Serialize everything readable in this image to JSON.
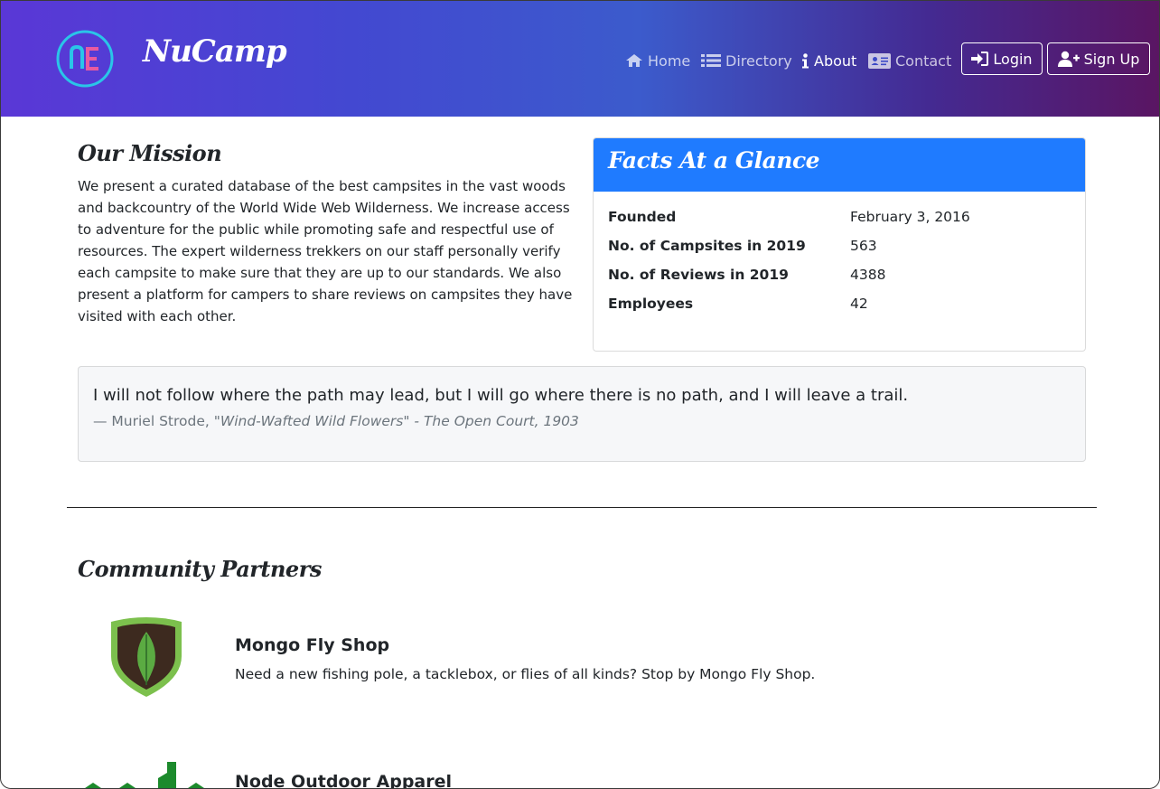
{
  "header": {
    "brand": "NuCamp",
    "nav": [
      {
        "label": "Home",
        "icon": "home-icon",
        "active": false
      },
      {
        "label": "Directory",
        "icon": "list-icon",
        "active": false
      },
      {
        "label": "About",
        "icon": "info-icon",
        "active": true
      },
      {
        "label": "Contact",
        "icon": "address-card-icon",
        "active": false
      }
    ],
    "login_label": "Login",
    "signup_label": "Sign Up"
  },
  "mission": {
    "title": "Our Mission",
    "text": "We present a curated database of the best campsites in the vast woods and backcountry of the World Wide Web Wilderness. We increase access to adventure for the public while promoting safe and respectful use of resources. The expert wilderness trekkers on our staff personally verify each campsite to make sure that they are up to our standards. We also present a platform for campers to share reviews on campsites they have visited with each other."
  },
  "facts": {
    "title": "Facts At a Glance",
    "rows": [
      {
        "label": "Founded",
        "value": "February 3, 2016"
      },
      {
        "label": "No. of Campsites in 2019",
        "value": "563"
      },
      {
        "label": "No. of Reviews in 2019",
        "value": "4388"
      },
      {
        "label": "Employees",
        "value": "42"
      }
    ]
  },
  "quote": {
    "text": "I will not follow where the path may lead, but I will go where there is no path, and I will leave a trail.",
    "author": "— Muriel Strode, ",
    "source": "\"Wind-Wafted Wild Flowers\" - The Open Court, 1903"
  },
  "partners": {
    "title": "Community Partners",
    "items": [
      {
        "name": "Mongo Fly Shop",
        "description": "Need a new fishing pole, a tacklebox, or flies of all kinds? Stop by Mongo Fly Shop."
      },
      {
        "name": "Node Outdoor Apparel",
        "description": ""
      }
    ]
  },
  "colors": {
    "header_gradient_start": "#5a37d6",
    "header_gradient_end": "#5a1562",
    "facts_header": "#1f7bff",
    "quote_bg": "#f6f7f9"
  }
}
